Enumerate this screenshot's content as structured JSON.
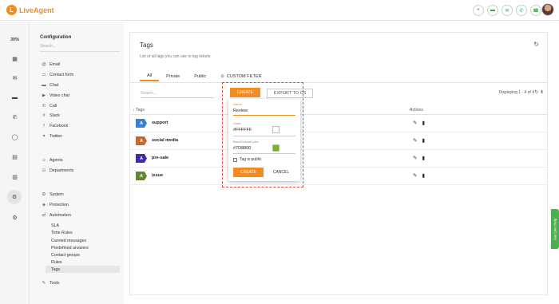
{
  "brand": {
    "name": "LiveAgent",
    "logo_letter": "L",
    "accent": "#f28c22"
  },
  "header": {
    "icons": [
      "plus-circle-icon",
      "chat-icon",
      "email-icon",
      "phone-icon",
      "call-icon"
    ],
    "avatar": "user-avatar"
  },
  "rail": {
    "percent": "30%",
    "items": [
      "dashboard-icon",
      "tickets-icon",
      "chat-icon",
      "calls-icon",
      "reports-icon",
      "contacts-icon",
      "companies-icon",
      "configuration-icon",
      "plugins-icon"
    ]
  },
  "sidebar": {
    "title": "Configuration",
    "search_placeholder": "Search...",
    "channels": [
      {
        "label": "Email",
        "icon": "at-icon"
      },
      {
        "label": "Contact form",
        "icon": "form-icon"
      },
      {
        "label": "Chat",
        "icon": "chat-icon"
      },
      {
        "label": "Video chat",
        "icon": "video-icon"
      },
      {
        "label": "Call",
        "icon": "phone-icon"
      },
      {
        "label": "Slack",
        "icon": "slack-icon"
      },
      {
        "label": "Facebook",
        "icon": "facebook-icon"
      },
      {
        "label": "Twitter",
        "icon": "twitter-icon"
      }
    ],
    "people": [
      {
        "label": "Agents",
        "icon": "agents-icon"
      },
      {
        "label": "Departments",
        "icon": "departments-icon"
      }
    ],
    "system": [
      {
        "label": "System",
        "icon": "gear-icon"
      },
      {
        "label": "Protection",
        "icon": "shield-icon"
      },
      {
        "label": "Automation",
        "icon": "automation-icon"
      }
    ],
    "automation_sub": [
      "SLA",
      "Time Rules",
      "Canned messages",
      "Predefined answers",
      "Contact groups",
      "Rules",
      "Tags"
    ],
    "tools": {
      "label": "Tools",
      "icon": "wrench-icon"
    }
  },
  "main": {
    "title": "Tags",
    "description": "List of all tags you can use to tag tickets.",
    "tabs": [
      "All",
      "Private",
      "Public"
    ],
    "custom_filter": "CUSTOM FILTER",
    "search_placeholder": "Search...",
    "create_label": "CREATE",
    "export_label": "EXPORT TO CS",
    "displaying": "Displaying 1 - 4 of 4",
    "col_tags": "Tags",
    "col_actions": "Actions",
    "rows": [
      {
        "letter": "A",
        "name": "support",
        "color": "#3a7fd5"
      },
      {
        "letter": "A",
        "name": "social media",
        "color": "#c8682a"
      },
      {
        "letter": "A",
        "name": "pre-sale",
        "color": "#3c2ea8"
      },
      {
        "letter": "A",
        "name": "issue",
        "color": "#5b8a33"
      }
    ]
  },
  "popup": {
    "create_label": "CREATE",
    "name_label": "Name",
    "name_value": "Review",
    "color_label": "Color",
    "color_value": "#FFFFFF",
    "bg_label": "BackGroundColor",
    "bg_value": "#7D8800",
    "bg_swatch": "#7cad2f",
    "public_label": "Tag is public",
    "ok_label": "CREATE",
    "cancel_label": "CANCEL"
  },
  "live_help": "Get Live Help"
}
